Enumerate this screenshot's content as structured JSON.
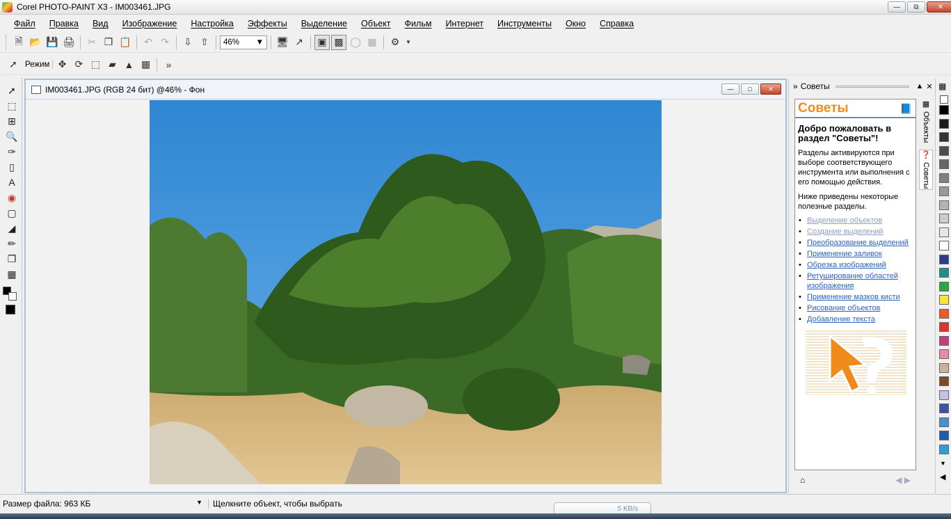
{
  "window": {
    "title": "Corel PHOTO-PAINT X3 - IM003461.JPG"
  },
  "menu": [
    "Файл",
    "Правка",
    "Вид",
    "Изображение",
    "Настройка",
    "Эффекты",
    "Выделение",
    "Объект",
    "Фильм",
    "Интернет",
    "Инструменты",
    "Окно",
    "Справка"
  ],
  "toolbar": {
    "zoom": "46%",
    "mode_label": "Режим"
  },
  "document": {
    "title": "IM003461.JPG (RGB 24 бит) @46% - Фон"
  },
  "docker": {
    "header": "Советы",
    "title": "Советы",
    "heading": "Добро пожаловать в раздел \"Советы\"!",
    "para1": "Разделы активируются при выборе соответствующего инструмента или выполнения с его помощью действия.",
    "para2": "Ниже приведены некоторые полезные разделы.",
    "links": [
      "Выделение объектов",
      "Создание выделений",
      "Преобразование выделений",
      "Применение заливок",
      "Обрезка изображений",
      "Ретуширование областей изображения",
      "Применение мазков кисти",
      "Рисование объектов",
      "Добавление текста"
    ],
    "tabs": [
      "Объекты",
      "Советы"
    ]
  },
  "palette_colors": [
    "#000000",
    "#1a1a1a",
    "#333333",
    "#4d4d4d",
    "#666666",
    "#808080",
    "#999999",
    "#b3b3b3",
    "#cccccc",
    "#e6e6e6",
    "#ffffff",
    "#2e3a8c",
    "#1e8f8a",
    "#27a845",
    "#f3e53a",
    "#ee5a24",
    "#e4312b",
    "#c43c7a",
    "#e88aa8",
    "#c8b49a",
    "#7a4a2a",
    "#c6c2de",
    "#3d52a1",
    "#4a8fd0",
    "#1c5fa8",
    "#2ea0d8"
  ],
  "status": {
    "file_size": "Размер файла: 963 КБ",
    "hint": "Щелкните объект, чтобы выбрать",
    "net": "5 KB/s"
  }
}
